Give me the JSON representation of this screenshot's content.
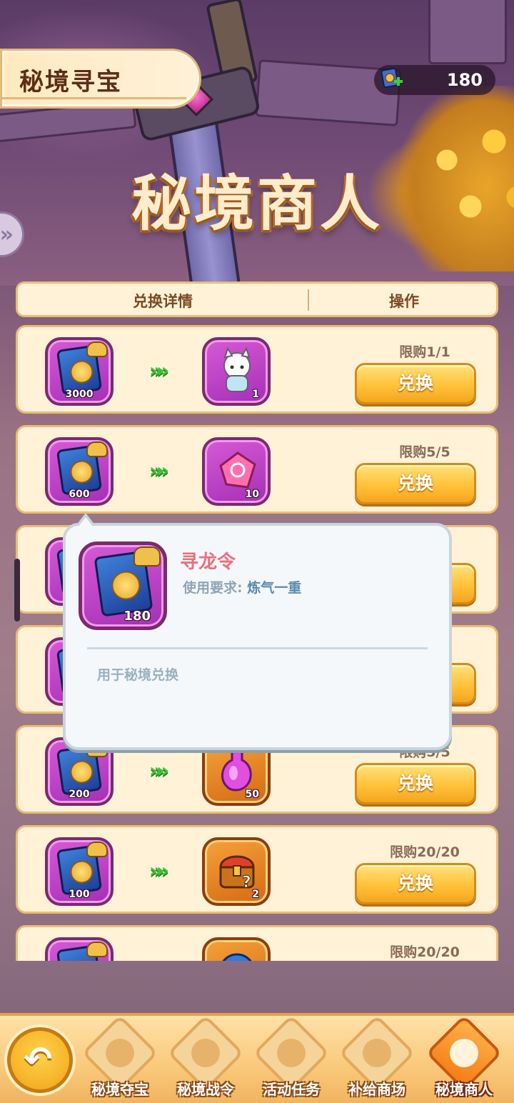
{
  "header": {
    "title": "秘境寻宝",
    "currency": {
      "icon": "dragon-token-plus-icon",
      "value": "180"
    },
    "banner_title": "秘境商人"
  },
  "table": {
    "col_details": "兑换详情",
    "col_action": "操作"
  },
  "rows": [
    {
      "cost_item": "dragon-token",
      "cost_qty": "3000",
      "reward_item": "fox-spirit-pet",
      "reward_qty": "1",
      "limit": "限购1/1",
      "button": "兑换"
    },
    {
      "cost_item": "dragon-token",
      "cost_qty": "600",
      "reward_item": "pink-fragment",
      "reward_qty": "10",
      "limit": "限购5/5",
      "button": "兑换"
    },
    {
      "cost_item": "dragon-token",
      "cost_qty": "",
      "reward_item": "hidden",
      "reward_qty": "",
      "limit": "",
      "button": ""
    },
    {
      "cost_item": "dragon-token",
      "cost_qty": "",
      "reward_item": "hidden",
      "reward_qty": "",
      "limit": "",
      "button": ""
    },
    {
      "cost_item": "dragon-token",
      "cost_qty": "200",
      "reward_item": "pink-potion",
      "reward_qty": "50",
      "limit": "限购5/5",
      "button": "兑换"
    },
    {
      "cost_item": "dragon-token",
      "cost_qty": "100",
      "reward_item": "mystery-chest",
      "reward_qty": "2",
      "limit": "限购20/20",
      "button": "兑换"
    },
    {
      "cost_item": "dragon-token",
      "cost_qty": "",
      "reward_item": "blue-orb",
      "reward_qty": "",
      "limit": "限购20/20",
      "button": ""
    }
  ],
  "tooltip": {
    "item_qty": "180",
    "name": "寻龙令",
    "req_label": "使用要求: ",
    "req_value": "炼气一重",
    "description": "用于秘境兑换"
  },
  "nav": {
    "back_icon": "back-arrow-icon",
    "tabs": [
      {
        "label": "秘境夺宝",
        "icon": "scroll-swirl-icon",
        "active": false
      },
      {
        "label": "秘境战令",
        "icon": "crown-leaf-icon",
        "active": false
      },
      {
        "label": "活动任务",
        "icon": "scroll-quest-icon",
        "active": false
      },
      {
        "label": "补给商场",
        "icon": "shop-crate-icon",
        "active": false
      },
      {
        "label": "秘境商人",
        "icon": "money-bag-icon",
        "active": true
      }
    ]
  },
  "colors": {
    "card_bg": "#fff2d6",
    "card_border": "#e9bd74",
    "button": "#ffc23a",
    "tooltip_name": "#ec6f7a"
  }
}
